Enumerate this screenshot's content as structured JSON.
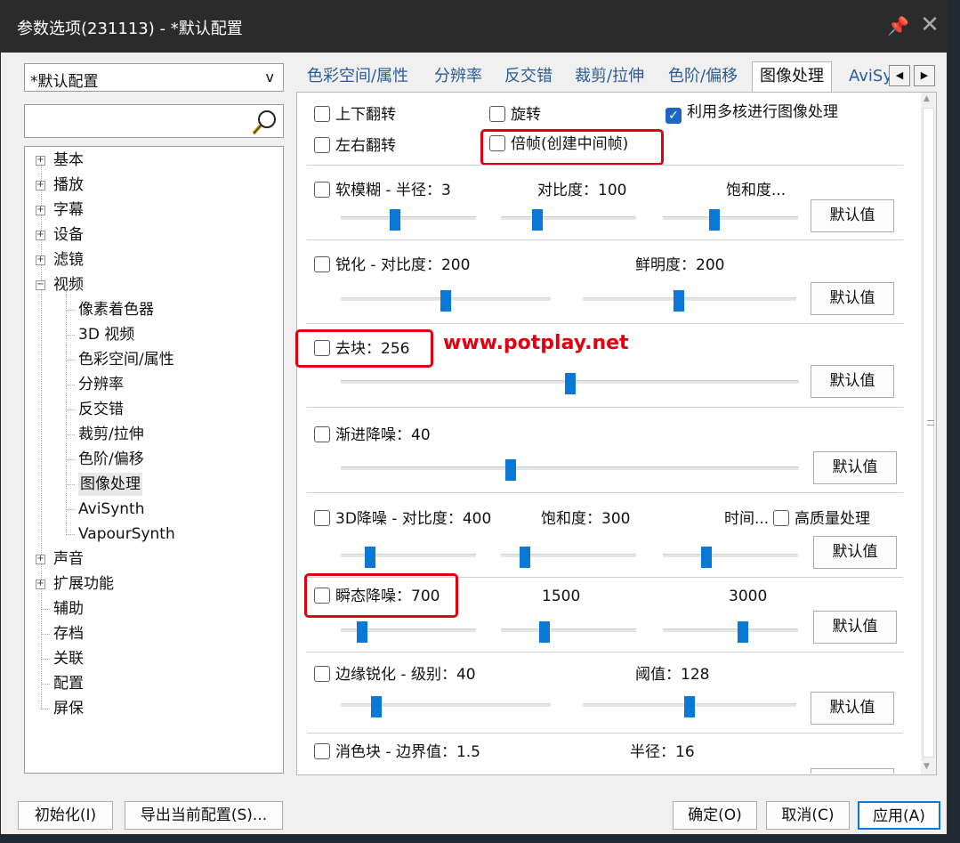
{
  "window": {
    "title": "参数选项(231113) - *默认配置"
  },
  "profile_combo": {
    "value": "*默认配置",
    "arrow": "v"
  },
  "search": {
    "placeholder": ""
  },
  "tree": {
    "top": [
      "基本",
      "播放",
      "字幕",
      "设备",
      "滤镜",
      "视频"
    ],
    "video_children": [
      "像素着色器",
      "3D 视频",
      "色彩空间/属性",
      "分辨率",
      "反交错",
      "裁剪/拉伸",
      "色阶/偏移",
      "图像处理",
      "AviSynth",
      "VapourSynth"
    ],
    "bottom_expandable": [
      "声音",
      "扩展功能"
    ],
    "bottom_leaf": [
      "辅助",
      "存档",
      "关联",
      "配置",
      "屏保"
    ],
    "expand_symbol": "+",
    "collapse_symbol": "−"
  },
  "tabs": [
    "色彩空间/属性",
    "分辨率",
    "反交错",
    "裁剪/拉伸",
    "色阶/偏移",
    "图像处理",
    "AviSy"
  ],
  "tab_active": "图像处理",
  "options": {
    "flip_vertical": {
      "label": "上下翻转",
      "checked": false
    },
    "rotate": {
      "label": "旋转",
      "checked": false
    },
    "multicore": {
      "label": "利用多核进行图像处理",
      "checked": true
    },
    "flip_horizontal": {
      "label": "左右翻转",
      "checked": false
    },
    "frame_double": {
      "label": "倍帧(创建中间帧)",
      "checked": false
    }
  },
  "soft_blur": {
    "label": "软模糊 - 半径：3",
    "contrast": "对比度：100",
    "saturation": "饱和度...",
    "sliders": [
      0.4,
      0.27,
      0.38
    ]
  },
  "sharpen": {
    "label": "锐化 - 对比度：200",
    "vividness": "鲜明度：200",
    "sliders": [
      0.5,
      0.45
    ]
  },
  "deblock": {
    "label": "去块：256",
    "slider": 0.5
  },
  "progressive_denoise": {
    "label": "渐进降噪：40",
    "slider": 0.37
  },
  "denoise_3d": {
    "label": "3D降噪 - 对比度：400",
    "saturation": "饱和度：300",
    "time": "时间...",
    "hq_label": "高质量处理",
    "sliders": [
      0.22,
      0.18,
      0.32
    ]
  },
  "transient_denoise": {
    "label": "瞬态降噪：700",
    "v2": "1500",
    "v3": "3000",
    "sliders": [
      0.16,
      0.32,
      0.59
    ]
  },
  "edge_sharpen": {
    "label": "边缘锐化 - 级别：40",
    "threshold": "阈值：128",
    "sliders": [
      0.17,
      0.5
    ]
  },
  "color_deblock": {
    "label": "消色块 - 边界值：1.5",
    "radius": "半径：16"
  },
  "default_button": "默认值",
  "watermark": "www.potplay.net",
  "footer": {
    "init": "初始化(I)",
    "export": "导出当前配置(S)...",
    "ok": "确定(O)",
    "cancel": "取消(C)",
    "apply": "应用(A)"
  },
  "colors": {
    "accent": "#0a78d7",
    "highlight": "#e0000f",
    "titlebar": "#2b2b2b"
  }
}
